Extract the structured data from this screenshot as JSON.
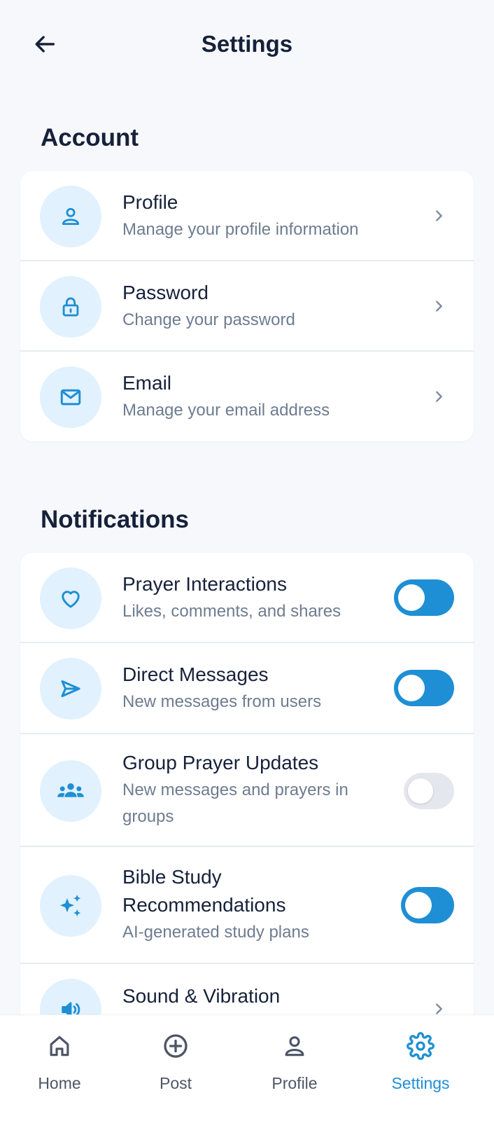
{
  "header": {
    "title": "Settings"
  },
  "account": {
    "section_title": "Account",
    "items": [
      {
        "title": "Profile",
        "subtitle": "Manage your profile information",
        "icon": "user-icon"
      },
      {
        "title": "Password",
        "subtitle": "Change your password",
        "icon": "lock-icon"
      },
      {
        "title": "Email",
        "subtitle": "Manage your email address",
        "icon": "mail-icon"
      }
    ]
  },
  "notifications": {
    "section_title": "Notifications",
    "items": [
      {
        "title": "Prayer Interactions",
        "subtitle": "Likes, comments, and shares",
        "icon": "heart-icon",
        "enabled": true
      },
      {
        "title": "Direct Messages",
        "subtitle": "New messages from users",
        "icon": "send-icon",
        "enabled": true
      },
      {
        "title": "Group Prayer Updates",
        "subtitle": "New messages and prayers in groups",
        "icon": "group-icon",
        "enabled": false
      },
      {
        "title": "Bible Study Recommendations",
        "subtitle": "AI-generated study plans",
        "icon": "sparkle-icon",
        "enabled": true
      },
      {
        "title": "Sound & Vibration",
        "icon": "speaker-icon"
      }
    ]
  },
  "nav": {
    "items": [
      {
        "label": "Home",
        "icon": "home-icon",
        "active": false
      },
      {
        "label": "Post",
        "icon": "plus-circle-icon",
        "active": false
      },
      {
        "label": "Profile",
        "icon": "user-icon",
        "active": false
      },
      {
        "label": "Settings",
        "icon": "gear-icon",
        "active": true
      }
    ]
  },
  "colors": {
    "accent": "#1e8fd5",
    "icon_bg": "#e1f1fd",
    "background": "#f6f8fb",
    "text_primary": "#16213a",
    "text_secondary": "#6e7c90"
  }
}
